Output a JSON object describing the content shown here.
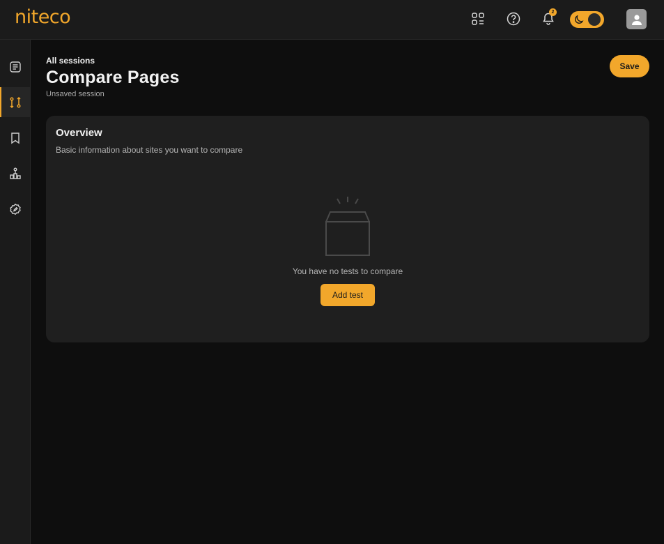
{
  "app": {
    "logo": "niteco"
  },
  "header": {
    "icons": [
      "apps-icon",
      "help-icon",
      "bell-icon"
    ],
    "notification_count": "2",
    "theme_toggle": {
      "mode": "dark",
      "icon": "moon-icon"
    },
    "avatar_icon": "user-icon"
  },
  "sidebar": {
    "items": [
      {
        "icon": "document-list-icon",
        "active": false
      },
      {
        "icon": "compare-icon",
        "active": true
      },
      {
        "icon": "bookmark-icon",
        "active": false
      },
      {
        "icon": "hierarchy-icon",
        "active": false
      },
      {
        "icon": "edit-badge-icon",
        "active": false
      }
    ]
  },
  "page": {
    "breadcrumb": "All sessions",
    "title": "Compare Pages",
    "subtitle": "Unsaved session",
    "save_label": "Save"
  },
  "overview": {
    "title": "Overview",
    "description": "Basic information about sites you want to compare",
    "empty_text": "You have no tests to compare",
    "add_label": "Add test"
  },
  "colors": {
    "accent": "#f2a72b",
    "background": "#0e0e0e",
    "surface": "#1b1b1b",
    "card": "#1f1f1f"
  }
}
